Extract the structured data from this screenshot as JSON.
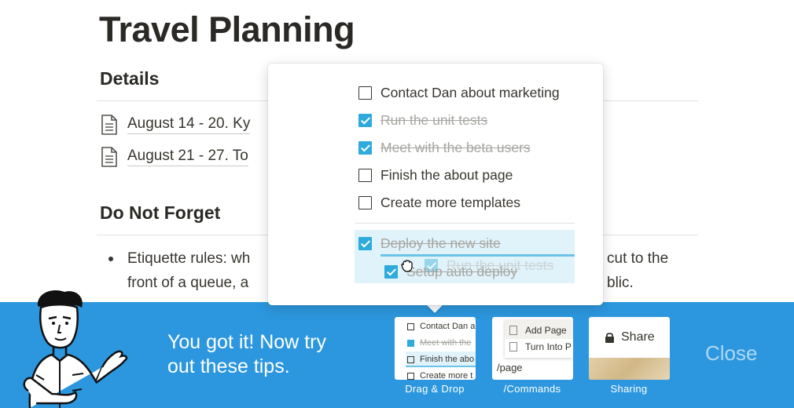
{
  "page": {
    "title": "Travel Planning",
    "details_heading": "Details",
    "links": [
      "August 14 - 20. Ky",
      "August 21 - 27. To"
    ],
    "forget_heading": "Do Not Forget",
    "bullet_line1_start": "Etiquette rules: wh",
    "bullet_line1_end": "cut to the",
    "bullet_line2_start": "front of a queue, a",
    "bullet_line2_end": "blic."
  },
  "popup": {
    "todos": [
      {
        "label": "Contact Dan about marketing",
        "checked": false
      },
      {
        "label": "Run the unit tests",
        "checked": true
      },
      {
        "label": "Meet with the beta users",
        "checked": true
      },
      {
        "label": "Finish the about page",
        "checked": false
      },
      {
        "label": "Create more templates",
        "checked": false
      }
    ],
    "drag_items": [
      {
        "label": "Deploy the new site",
        "checked": true
      },
      {
        "label": "Setup auto deploy",
        "checked": true
      }
    ],
    "dragging_ghost": "Run the unit tests"
  },
  "banner": {
    "line1": "You got it! Now try",
    "line2": "out these tips.",
    "close_label": "Close",
    "tips": [
      {
        "label": "Drag & Drop",
        "preview": [
          "Contact Dan a",
          "Meet with the",
          "Finish the abo",
          "Create more t"
        ]
      },
      {
        "label": "/Commands",
        "preview": [
          "Add Page",
          "Turn Into P",
          "/page"
        ]
      },
      {
        "label": "Sharing",
        "preview": [
          "Share"
        ]
      }
    ]
  },
  "colors": {
    "banner": "#2c97de",
    "checkbox_accent": "#2eaadc"
  }
}
